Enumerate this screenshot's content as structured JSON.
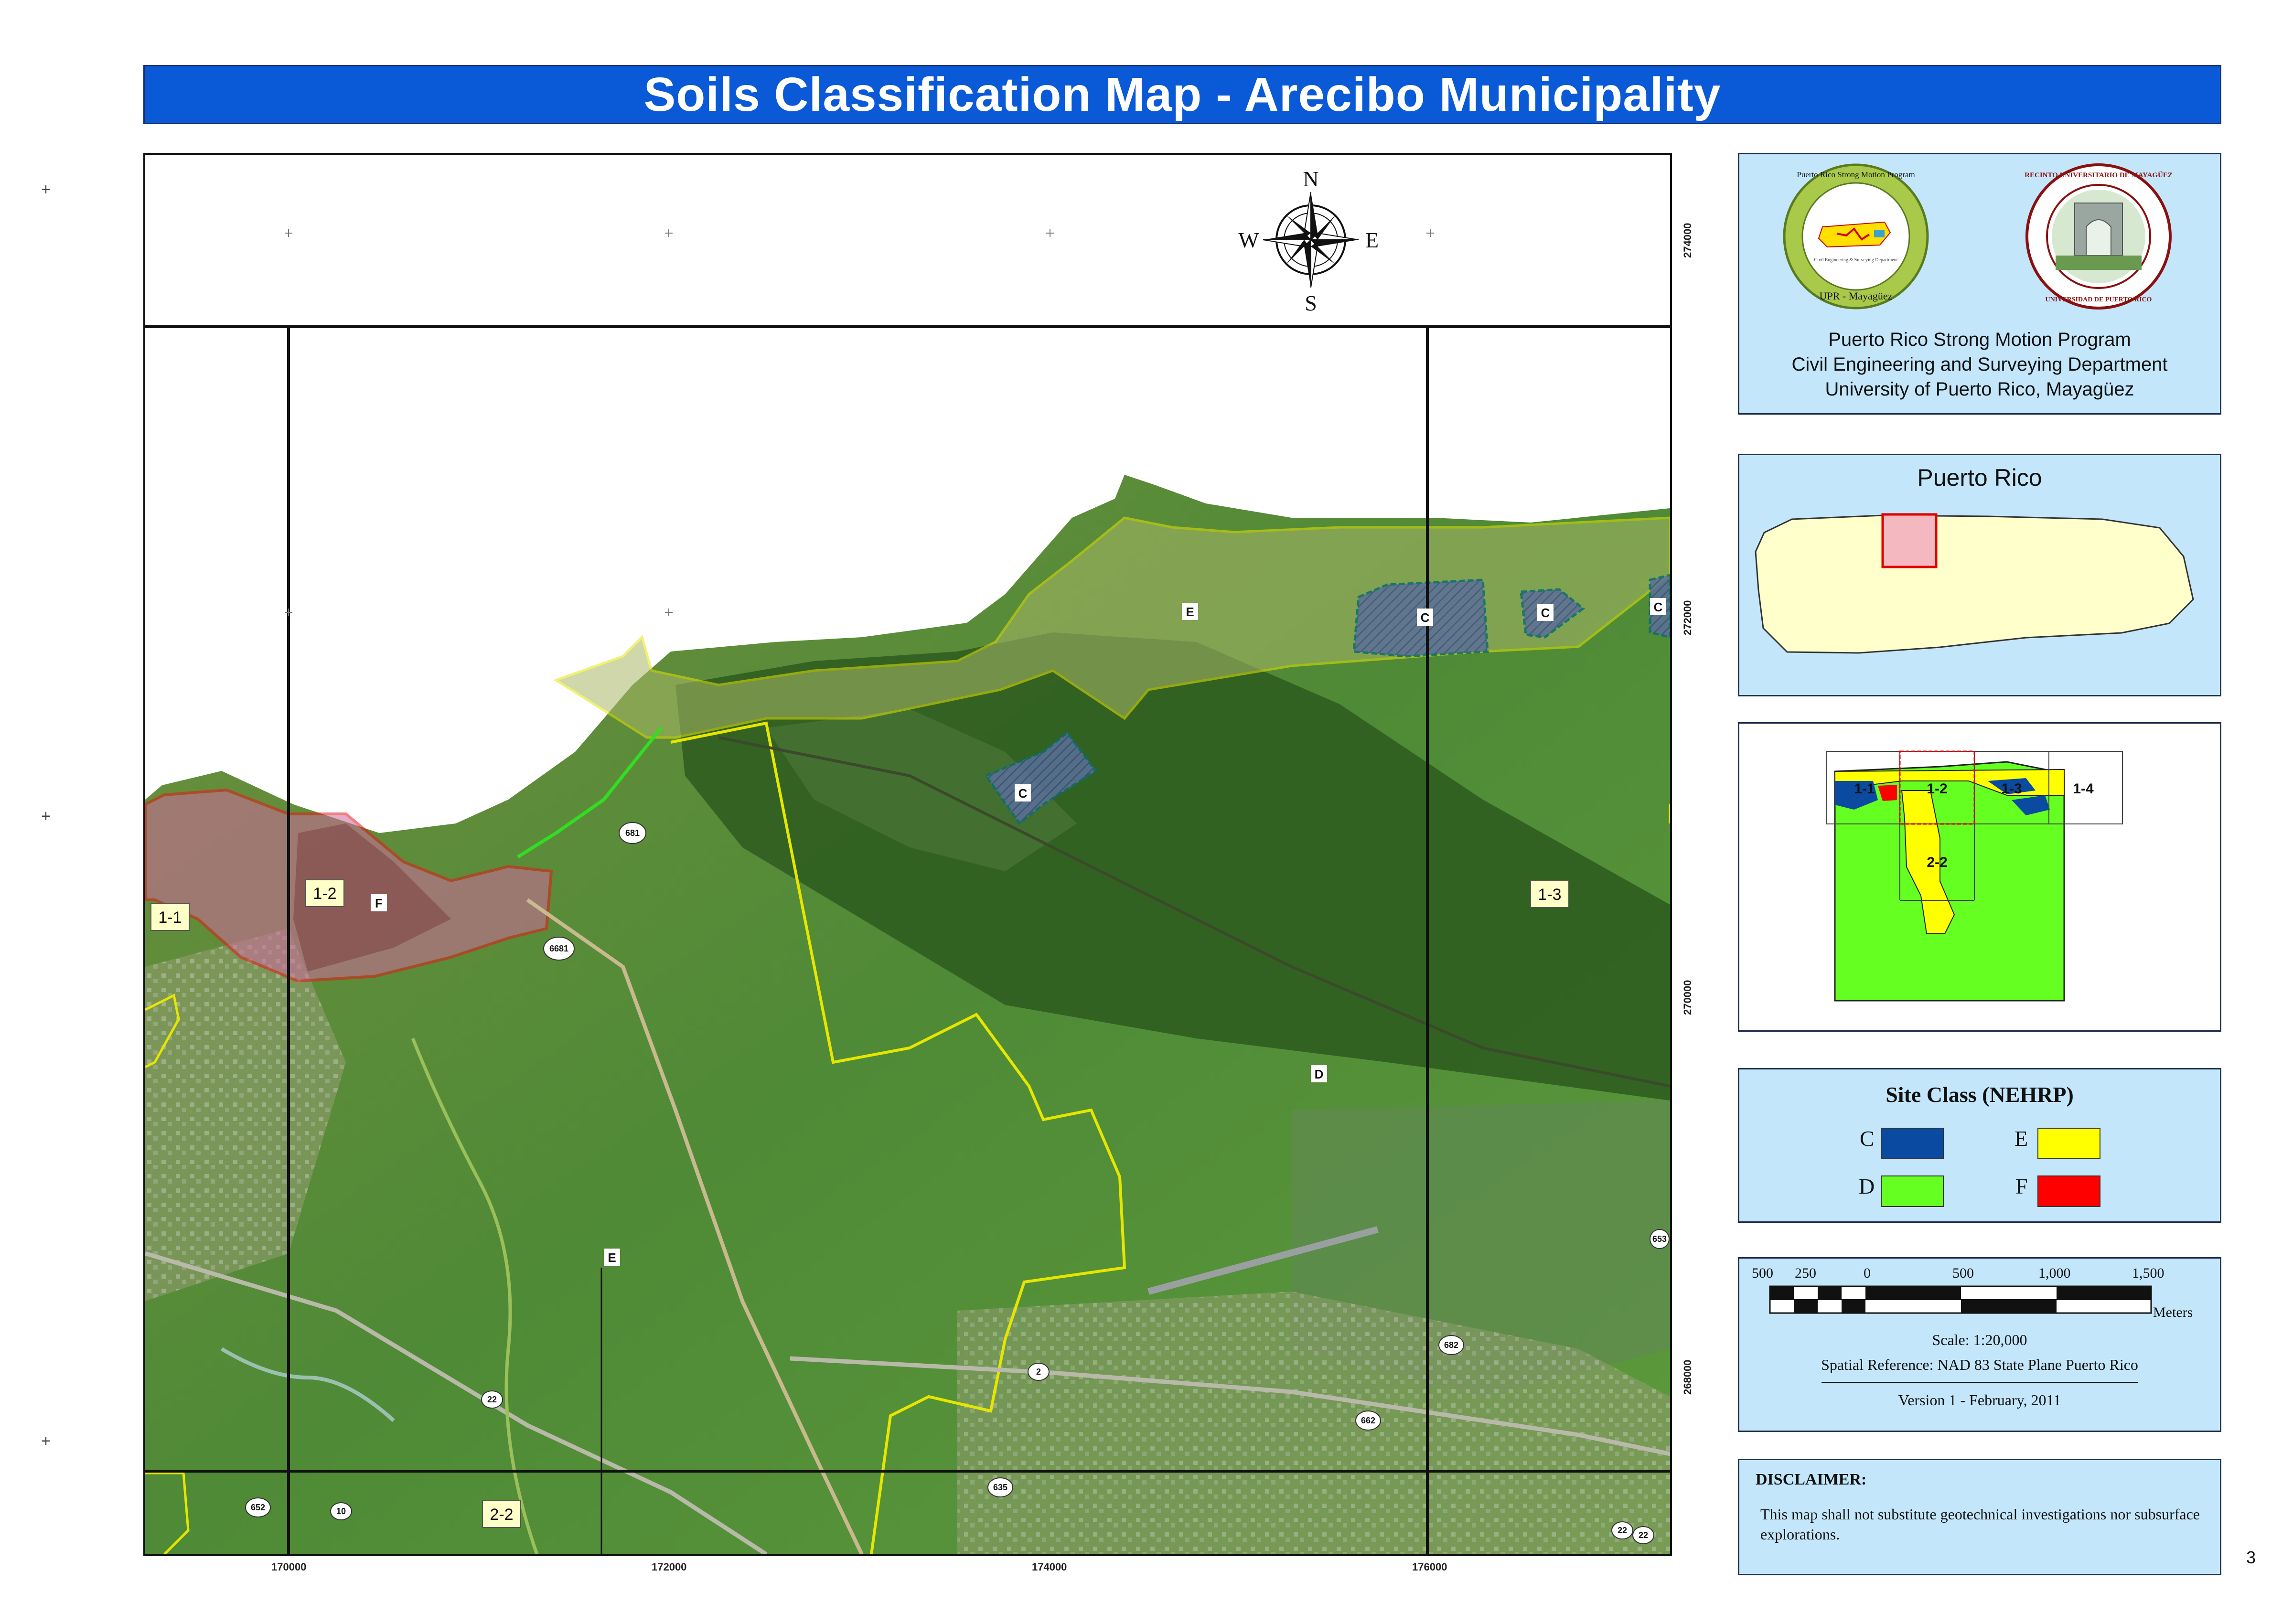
{
  "title": "Soils Classification Map - Arecibo Municipality",
  "page_number": "3",
  "colors": {
    "title_bg": "#0a5ad8",
    "panel_bg": "#c3e6fb",
    "class_C": "#0a4aa0",
    "class_D": "#66ff22",
    "class_E": "#ffff00",
    "class_F": "#ff0000"
  },
  "map": {
    "north_arrow": {
      "n": "N",
      "s": "S",
      "e": "E",
      "w": "W"
    },
    "x_ticks": [
      "170000",
      "172000",
      "174000",
      "176000"
    ],
    "y_ticks": [
      "274000",
      "272000",
      "270000",
      "268000"
    ],
    "grid_labels": [
      "1-1",
      "1-2",
      "1-3",
      "2-2"
    ],
    "zone_labels": {
      "e_coast": "E",
      "e_south": "E",
      "d_main": "D",
      "f_west": "F",
      "c_lagoon": "C",
      "c_east_1": "C",
      "c_east_2": "C",
      "c_east_3": "C"
    },
    "road_shields": [
      "681",
      "6681",
      "2",
      "22",
      "662",
      "682",
      "652",
      "10",
      "635",
      "22",
      "22",
      "653"
    ]
  },
  "logo_panel": {
    "logo_left_ring": "Puerto Rico Strong Motion Program",
    "logo_left_bottom": "UPR - Mayagüez",
    "logo_left_inner": "Civil Engineering & Surveying Department",
    "logo_right_ring": "RECINTO UNIVERSITARIO DE MAYAGÜEZ",
    "logo_right_bottom": "UNIVERSIDAD DE PUERTO RICO",
    "line1": "Puerto Rico Strong Motion Program",
    "line2": "Civil Engineering and Surveying Department",
    "line3": "University of Puerto Rico, Mayagüez"
  },
  "locator": {
    "title": "Puerto Rico"
  },
  "index_map": {
    "labels": [
      "1-1",
      "1-2",
      "1-3",
      "1-4",
      "2-2"
    ]
  },
  "legend": {
    "title": "Site Class (NEHRP)",
    "items": [
      {
        "label": "C",
        "color": "#0a4aa0"
      },
      {
        "label": "E",
        "color": "#ffff00"
      },
      {
        "label": "D",
        "color": "#66ff22"
      },
      {
        "label": "F",
        "color": "#ff0000"
      }
    ]
  },
  "scale": {
    "ticks": [
      "500",
      "250",
      "0",
      "500",
      "1,000",
      "1,500"
    ],
    "units": "Meters",
    "scale_text": "Scale:  1:20,000",
    "spatial_reference": "Spatial Reference: NAD 83 State Plane Puerto Rico",
    "version": "Version 1 - February, 2011"
  },
  "disclaimer": {
    "title": "DISCLAIMER:",
    "text": "This map shall not substitute geotechnical investigations nor subsurface explorations."
  }
}
